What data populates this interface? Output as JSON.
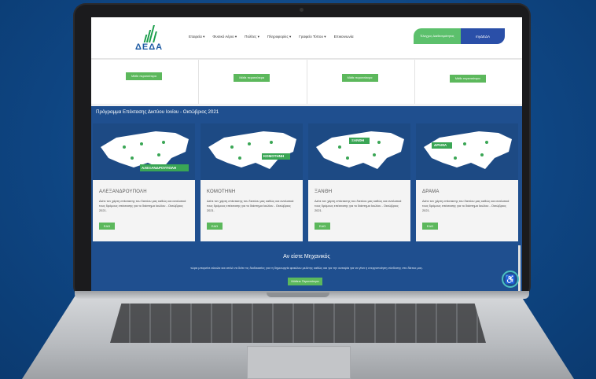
{
  "logo_text": "ΔΕΔΑ",
  "nav": [
    "Εταιρεία ▾",
    "Φυσικό Αέριο ▾",
    "Πολίτες ▾",
    "Πληροφορίες ▾",
    "Γραφείο Τύπου ▾",
    "Επικοινωνία"
  ],
  "cta": {
    "left": "Έλεγχος Διαθεσιμότητας",
    "right": "myΔΕΔΑ"
  },
  "more_button": "Μάθε περισσότερα",
  "band_title": "Πρόγραμμα Επέκτασης Δικτύου Ιονίου - Οκτώβριος 2021",
  "cards": [
    {
      "title": "ΑΛΕΞΑΝΔΡΟΥΠΟΛΗ",
      "map_label": "ΑΛΕΞΑΝΔΡΟΥΠΟΛΗ",
      "desc": "Δείτε τον χάρτη επέκτασης του δικτύου μας καθώς και αναλυτικά τους δρόμους επέκτασης για το διάστημα Ιουλίου - Οκτώβριος 2021.",
      "button": "ΕΔΩ"
    },
    {
      "title": "ΚΟΜΟΤΗΝΗ",
      "map_label": "ΚΟΜΟΤΗΝΗ",
      "desc": "Δείτε τον χάρτη επέκτασης του δικτύου μας καθώς και αναλυτικά τους δρόμους επέκτασης για το διάστημα Ιουλίου - Οκτώβριος 2021.",
      "button": "ΕΔΩ"
    },
    {
      "title": "ΞΑΝΘΗ",
      "map_label": "ΞΑΝΘΗ",
      "desc": "Δείτε τον χάρτη επέκτασης του δικτύου μας καθώς και αναλυτικά τους δρόμους επέκτασης για το διάστημα Ιουλίου - Οκτώβριος 2021.",
      "button": "ΕΔΩ"
    },
    {
      "title": "ΔΡΑΜΑ",
      "map_label": "ΔΡΑΜΑ",
      "desc": "Δείτε τον χάρτη επέκτασης του δικτύου μας καθώς και αναλυτικά τους δρόμους επέκτασης για το διάστημα Ιουλίου - Οκτώβριος 2021.",
      "button": "ΕΔΩ"
    }
  ],
  "engineers": {
    "title": "Αν είστε Μηχανικός",
    "subtitle": "τώρα μπορείτε εύκολα και απλά να δείτε τις διαδικασίες για τη δημιουργία φακέλου μελέτης καθώς και για την αυτοψία για να γίνει η ενεργοποίηση σύνδεσης στο δίκτυο μας.",
    "button": "Μάθετε Περισσότερα"
  },
  "colors": {
    "green": "#5cb85c",
    "blue": "#1f4f8f",
    "brand_blue": "#2a4fa8"
  }
}
